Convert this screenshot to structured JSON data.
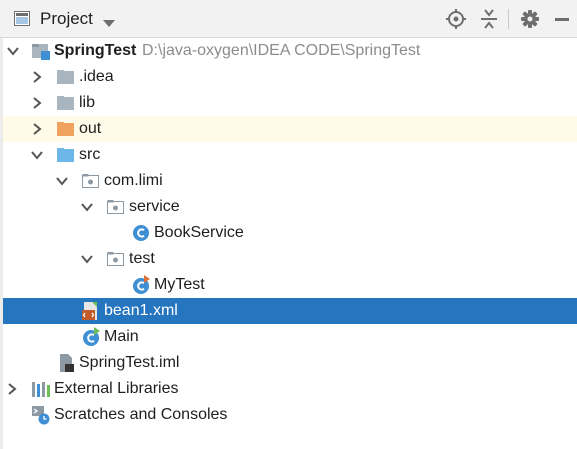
{
  "panel": {
    "title": "Project",
    "toolbar": {
      "locate": "crosshair-icon",
      "collapse": "collapse-all-icon",
      "settings": "gear-icon",
      "hide": "minimize-icon"
    }
  },
  "tree": {
    "root": {
      "name": "SpringTest",
      "path": "D:\\java-oxygen\\IDEA CODE\\SpringTest"
    },
    "idea": ".idea",
    "lib": "lib",
    "out": "out",
    "src": "src",
    "pkg": "com.limi",
    "service_pkg": "service",
    "book_service": "BookService",
    "test_pkg": "test",
    "my_test": "MyTest",
    "bean_xml": "bean1.xml",
    "main": "Main",
    "iml": "SpringTest.iml",
    "external": "External Libraries",
    "scratches": "Scratches and Consoles"
  },
  "colors": {
    "selection": "#2675bf",
    "highlight_row": "#fffbe8",
    "folder": "#a9b5bf",
    "source_folder": "#6cb6e8",
    "excluded_folder": "#f0a35e",
    "class_icon": "#3e8fd4"
  }
}
